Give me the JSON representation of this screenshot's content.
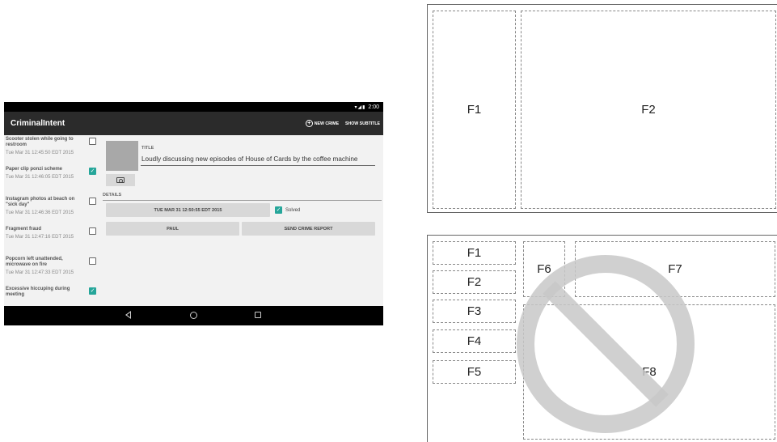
{
  "tablet": {
    "status_time": "2:00",
    "status_icons": "▾◢▮",
    "app_title": "CriminalIntent",
    "actions": {
      "new_crime": "NEW CRIME",
      "show_subtitle": "SHOW SUBTITLE"
    },
    "crimes": [
      {
        "title": "Scooter stolen while going to restroom",
        "date": "Tue Mar 31 12:45:50 EDT 2015",
        "solved": false
      },
      {
        "title": "Paper clip ponzi scheme",
        "date": "Tue Mar 31 12:46:05 EDT 2015",
        "solved": true
      },
      {
        "title": "Instagram photos at beach on \"sick day\"",
        "date": "Tue Mar 31 12:46:36 EDT 2015",
        "solved": false
      },
      {
        "title": "Fragment fraud",
        "date": "Tue Mar 31 12:47:16 EDT 2015",
        "solved": false
      },
      {
        "title": "Popcorn left unattended, microwave on fire",
        "date": "Tue Mar 31 12:47:33 EDT 2015",
        "solved": false
      },
      {
        "title": "Excessive hiccuping during meeting",
        "date": "",
        "solved": true
      }
    ],
    "detail": {
      "title_label": "TITLE",
      "title_value": "Loudly discussing new episodes of House of Cards by the coffee machine",
      "details_label": "DETAILS",
      "date_button": "TUE MAR 31 12:50:55 EDT 2015",
      "solved_label": "Solved",
      "suspect_button": "PAUL",
      "report_button": "SEND CRIME REPORT"
    }
  },
  "diagram_top": {
    "fragments": [
      "F1",
      "F2"
    ]
  },
  "diagram_bottom": {
    "fragments": [
      "F1",
      "F2",
      "F3",
      "F4",
      "F5",
      "F6",
      "F7",
      "F8"
    ]
  },
  "colors": {
    "accent": "#26a69a",
    "appbar": "#2b2b2b",
    "prohibit": "#c8c8c8"
  }
}
